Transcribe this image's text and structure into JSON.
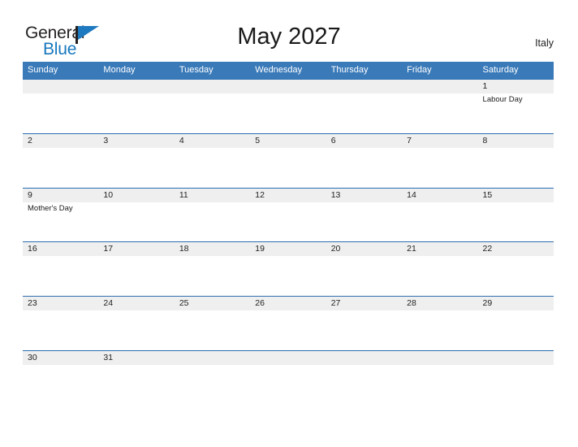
{
  "brand": {
    "name_part1": "General",
    "name_part2": "Blue",
    "flag_icon": "flag-icon"
  },
  "header": {
    "title": "May 2027",
    "country": "Italy"
  },
  "colors": {
    "header_blue": "#3a7ab9",
    "row_border_blue": "#2c6fb2",
    "date_band_gray": "#efefef",
    "logo_blue": "#1878be",
    "text_dark": "#231f20"
  },
  "calendar": {
    "month": "May",
    "year": "2027",
    "weekdays": [
      "Sunday",
      "Monday",
      "Tuesday",
      "Wednesday",
      "Thursday",
      "Friday",
      "Saturday"
    ],
    "weeks": [
      {
        "days": [
          {
            "num": "",
            "event": ""
          },
          {
            "num": "",
            "event": ""
          },
          {
            "num": "",
            "event": ""
          },
          {
            "num": "",
            "event": ""
          },
          {
            "num": "",
            "event": ""
          },
          {
            "num": "",
            "event": ""
          },
          {
            "num": "1",
            "event": "Labour Day"
          }
        ]
      },
      {
        "days": [
          {
            "num": "2",
            "event": ""
          },
          {
            "num": "3",
            "event": ""
          },
          {
            "num": "4",
            "event": ""
          },
          {
            "num": "5",
            "event": ""
          },
          {
            "num": "6",
            "event": ""
          },
          {
            "num": "7",
            "event": ""
          },
          {
            "num": "8",
            "event": ""
          }
        ]
      },
      {
        "days": [
          {
            "num": "9",
            "event": "Mother's Day"
          },
          {
            "num": "10",
            "event": ""
          },
          {
            "num": "11",
            "event": ""
          },
          {
            "num": "12",
            "event": ""
          },
          {
            "num": "13",
            "event": ""
          },
          {
            "num": "14",
            "event": ""
          },
          {
            "num": "15",
            "event": ""
          }
        ]
      },
      {
        "days": [
          {
            "num": "16",
            "event": ""
          },
          {
            "num": "17",
            "event": ""
          },
          {
            "num": "18",
            "event": ""
          },
          {
            "num": "19",
            "event": ""
          },
          {
            "num": "20",
            "event": ""
          },
          {
            "num": "21",
            "event": ""
          },
          {
            "num": "22",
            "event": ""
          }
        ]
      },
      {
        "days": [
          {
            "num": "23",
            "event": ""
          },
          {
            "num": "24",
            "event": ""
          },
          {
            "num": "25",
            "event": ""
          },
          {
            "num": "26",
            "event": ""
          },
          {
            "num": "27",
            "event": ""
          },
          {
            "num": "28",
            "event": ""
          },
          {
            "num": "29",
            "event": ""
          }
        ]
      },
      {
        "days": [
          {
            "num": "30",
            "event": ""
          },
          {
            "num": "31",
            "event": ""
          },
          {
            "num": "",
            "event": ""
          },
          {
            "num": "",
            "event": ""
          },
          {
            "num": "",
            "event": ""
          },
          {
            "num": "",
            "event": ""
          },
          {
            "num": "",
            "event": ""
          }
        ]
      }
    ]
  }
}
